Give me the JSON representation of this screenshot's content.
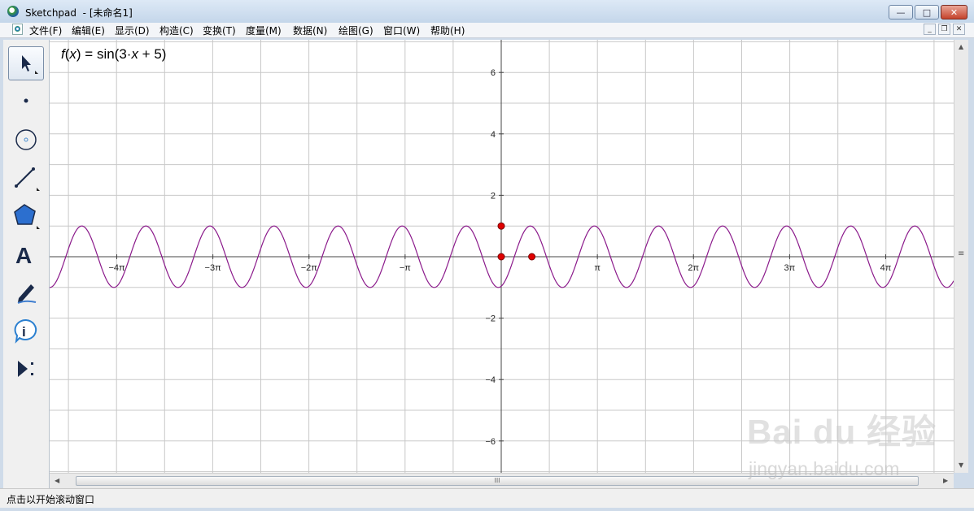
{
  "window": {
    "app_name": "Sketchpad",
    "document": "- [未命名1]",
    "minimize": "—",
    "restore": "□",
    "close": "✕"
  },
  "menu": {
    "items": [
      "文件(F)",
      "编辑(E)",
      "显示(D)",
      "构造(C)",
      "变换(T)",
      "度量(M)",
      "数据(N)",
      "绘图(G)",
      "窗口(W)",
      "帮助(H)"
    ],
    "mdi_minimize": "_",
    "mdi_restore": "❐",
    "mdi_close": "✕"
  },
  "toolbox": {
    "tools": [
      "arrow-select-icon",
      "point-icon",
      "compass-icon",
      "straightedge-icon",
      "polygon-icon",
      "text-icon",
      "marker-icon",
      "information-icon",
      "custom-tools-icon"
    ]
  },
  "graph": {
    "formula": {
      "f": "f",
      "open": "(",
      "x": "x",
      "mid": ") = sin(3·",
      "x2": "x",
      "tail": " + 5)"
    },
    "x_tick_labels": [
      "−4π",
      "−3π",
      "−2π",
      "−π",
      "π",
      "2π",
      "3π",
      "4π"
    ],
    "y_tick_labels": [
      "6",
      "4",
      "2",
      "−2",
      "−4",
      "−6"
    ],
    "curve_color": "#8b1a8b",
    "point_color": "#e00000"
  },
  "chart_data": {
    "type": "line",
    "function": "sin(3·x + 5)",
    "xlim": [
      -17.6,
      17.6
    ],
    "ylim": [
      -7,
      7
    ],
    "x_ticks": [
      -12.566,
      -9.425,
      -6.283,
      -3.142,
      3.142,
      6.283,
      9.425,
      12.566
    ],
    "y_ticks": [
      6,
      4,
      2,
      -2,
      -4,
      -6
    ],
    "grid": true,
    "points": [
      {
        "x": 0,
        "y": 1
      },
      {
        "x": 0,
        "y": 0
      },
      {
        "x": 1,
        "y": 0
      }
    ]
  },
  "scrollbar": {
    "grip": "III",
    "vgrip": "≡"
  },
  "status": {
    "text": "点击以开始滚动窗口"
  },
  "watermark": {
    "logo": "Bai du 经验",
    "url": "jingyan.baidu.com"
  }
}
